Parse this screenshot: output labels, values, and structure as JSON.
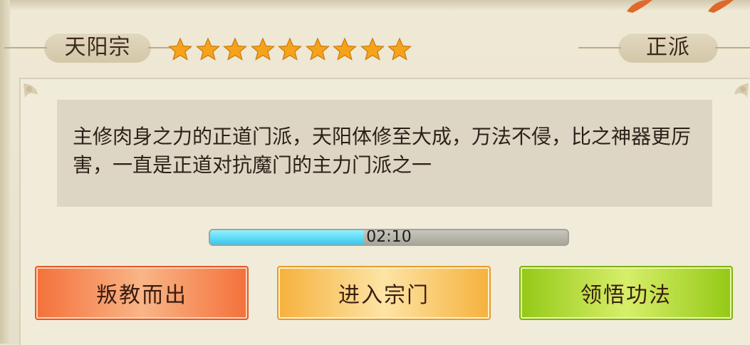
{
  "sect": {
    "name": "天阳宗",
    "alignment": "正派",
    "stars": 9,
    "star_color": "#f6a21b",
    "description": "主修肉身之力的正道门派，天阳体修至大成，万法不侵，比之神器更厉害，一直是正道对抗魔门的主力门派之一"
  },
  "timer": {
    "text": "02:10",
    "progress_fraction": 0.43,
    "fill_color": "#39c7f0"
  },
  "buttons": {
    "rebel_label": "叛教而出",
    "enter_label": "进入宗门",
    "learn_label": "领悟功法"
  },
  "icons": [
    "star-icon",
    "maple-leaf-icon",
    "corner-ornament-icon"
  ]
}
